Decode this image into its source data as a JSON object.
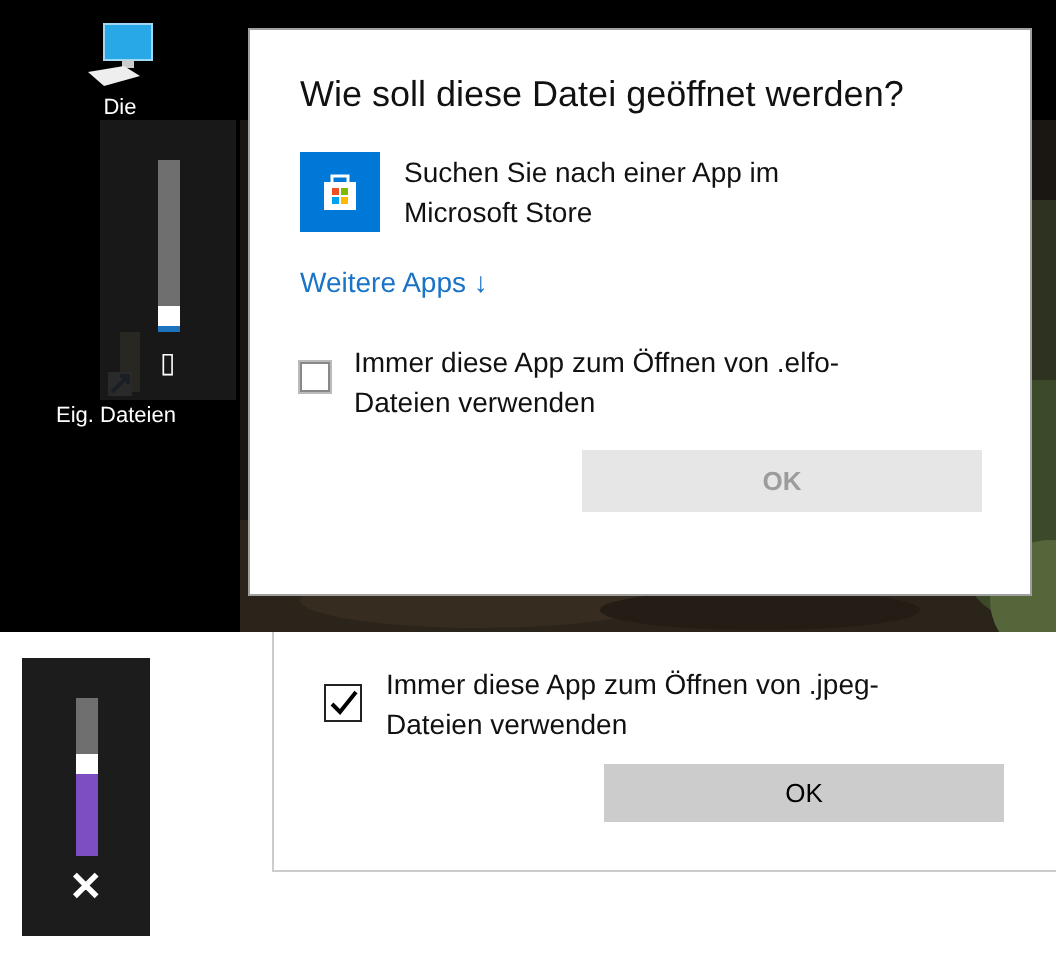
{
  "desktop": {
    "icons": [
      {
        "kind": "pc",
        "label": "Die"
      },
      {
        "kind": "folder",
        "label": "Eig. Dateien"
      }
    ]
  },
  "volume_flyouts": [
    {
      "level": 0.03,
      "color": "#1e73be",
      "glyph": "▯"
    },
    {
      "level": 0.52,
      "color": "#7b4fbf",
      "glyph": "✕"
    }
  ],
  "dialog": {
    "title": "Wie soll diese Datei geöffnet werden?",
    "store_option": "Suchen Sie nach einer App im Microsoft Store",
    "more_link": "Weitere Apps ↓",
    "checkbox": {
      "label": "Immer diese App zum Öffnen von .elfo-Dateien verwenden",
      "checked": false
    },
    "ok_button": {
      "label": "OK",
      "disabled": true
    }
  },
  "dialog_2": {
    "checkbox": {
      "label": "Immer diese App zum Öffnen von .jpeg-Dateien verwenden",
      "checked": true
    },
    "ok_button": {
      "label": "OK",
      "disabled": false
    }
  }
}
